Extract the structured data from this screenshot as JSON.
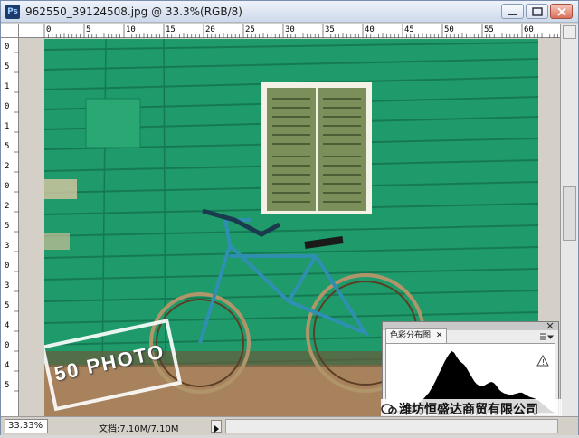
{
  "window": {
    "title": "962550_39124508.jpg @ 33.3%(RGB/8)",
    "app_icon_label": "Ps"
  },
  "ruler": {
    "horizontal": [
      "0",
      "5",
      "10",
      "15",
      "20",
      "25",
      "30",
      "35",
      "40",
      "45",
      "50",
      "55",
      "60"
    ],
    "vertical": [
      "0",
      "5",
      "1",
      "0",
      "1",
      "5",
      "2",
      "0",
      "2",
      "5",
      "3",
      "0",
      "3",
      "5",
      "4",
      "0",
      "4",
      "5"
    ]
  },
  "status": {
    "zoom": "33.33%",
    "doc_label": "文档:7.10M/7.10M"
  },
  "histogram_panel": {
    "tab_label": "色彩分布图",
    "values": [
      0,
      1,
      1,
      2,
      3,
      3,
      4,
      5,
      6,
      7,
      8,
      10,
      12,
      14,
      17,
      20,
      24,
      28,
      34,
      40,
      47,
      55,
      62,
      70,
      76,
      82,
      86,
      84,
      78,
      73,
      70,
      67,
      62,
      56,
      50,
      44,
      40,
      38,
      37,
      38,
      40,
      42,
      43,
      41,
      37,
      32,
      29,
      27,
      26,
      25,
      25,
      26,
      27,
      28,
      28,
      26,
      24,
      22,
      21,
      20,
      18,
      16,
      13,
      10,
      7,
      4,
      2
    ]
  },
  "overlay": {
    "brand_text": "潍坊恒盛达商贸有限公司",
    "stamp_text": "50 PHOTO"
  },
  "colors": {
    "wall": "#1f9a6a",
    "wall_light": "#2fb57d",
    "shutter": "#7a8f5a",
    "ground": "#a8825c",
    "bike": "#2f8fb0"
  }
}
